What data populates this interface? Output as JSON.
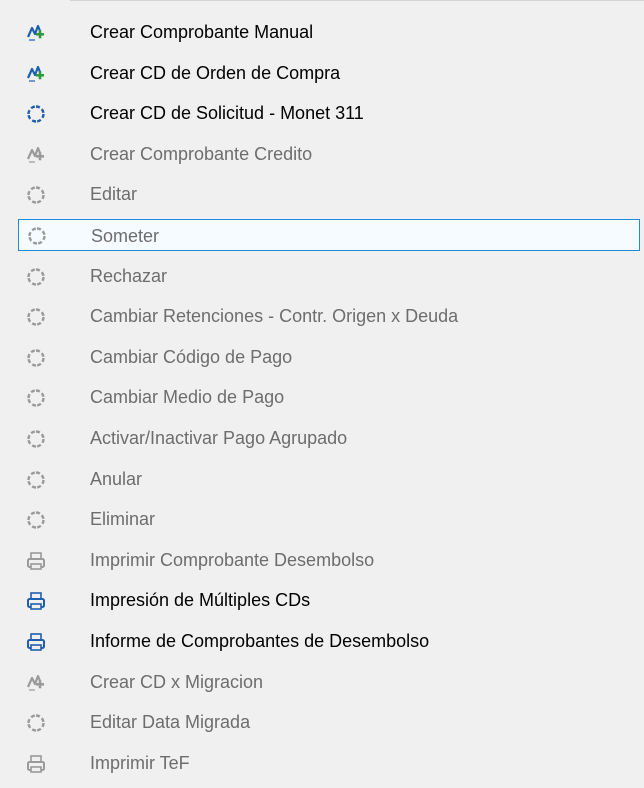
{
  "menu": {
    "items": [
      {
        "label": "Crear Comprobante Manual",
        "icon": "add-doc-icon",
        "enabled": true
      },
      {
        "label": "Crear CD de Orden de Compra",
        "icon": "add-doc-icon",
        "enabled": true
      },
      {
        "label": "Crear CD de Solicitud - Monet 311",
        "icon": "refresh-circle-icon",
        "enabled": true
      },
      {
        "label": "Crear Comprobante Credito",
        "icon": "add-doc-icon",
        "enabled": false
      },
      {
        "label": "Editar",
        "icon": "refresh-circle-icon",
        "enabled": false
      },
      {
        "label": "Someter",
        "icon": "refresh-circle-icon",
        "enabled": false,
        "highlighted": true
      },
      {
        "label": "Rechazar",
        "icon": "refresh-circle-icon",
        "enabled": false
      },
      {
        "label": "Cambiar Retenciones - Contr. Origen x Deuda",
        "icon": "refresh-circle-icon",
        "enabled": false
      },
      {
        "label": "Cambiar Código de Pago",
        "icon": "refresh-circle-icon",
        "enabled": false
      },
      {
        "label": "Cambiar Medio de Pago",
        "icon": "refresh-circle-icon",
        "enabled": false
      },
      {
        "label": "Activar/Inactivar Pago Agrupado",
        "icon": "refresh-circle-icon",
        "enabled": false
      },
      {
        "label": "Anular",
        "icon": "refresh-circle-icon",
        "enabled": false
      },
      {
        "label": "Eliminar",
        "icon": "refresh-circle-icon",
        "enabled": false
      },
      {
        "label": "Imprimir Comprobante Desembolso",
        "icon": "printer-icon",
        "enabled": false
      },
      {
        "label": "Impresión de Múltiples CDs",
        "icon": "printer-icon",
        "enabled": true
      },
      {
        "label": "Informe de Comprobantes de Desembolso",
        "icon": "printer-icon",
        "enabled": true
      },
      {
        "label": "Crear CD x Migracion",
        "icon": "add-doc-icon",
        "enabled": false
      },
      {
        "label": "Editar Data Migrada",
        "icon": "refresh-circle-icon",
        "enabled": false
      },
      {
        "label": "Imprimir TeF",
        "icon": "printer-icon",
        "enabled": false
      }
    ]
  },
  "colors": {
    "enabled_text": "#000000",
    "disabled_text": "#6d6d6d",
    "highlight_border": "#1f8bd6",
    "icon_blue": "#1e5fb0",
    "icon_green": "#2e9b3a",
    "icon_gray": "#9a9a9a"
  }
}
